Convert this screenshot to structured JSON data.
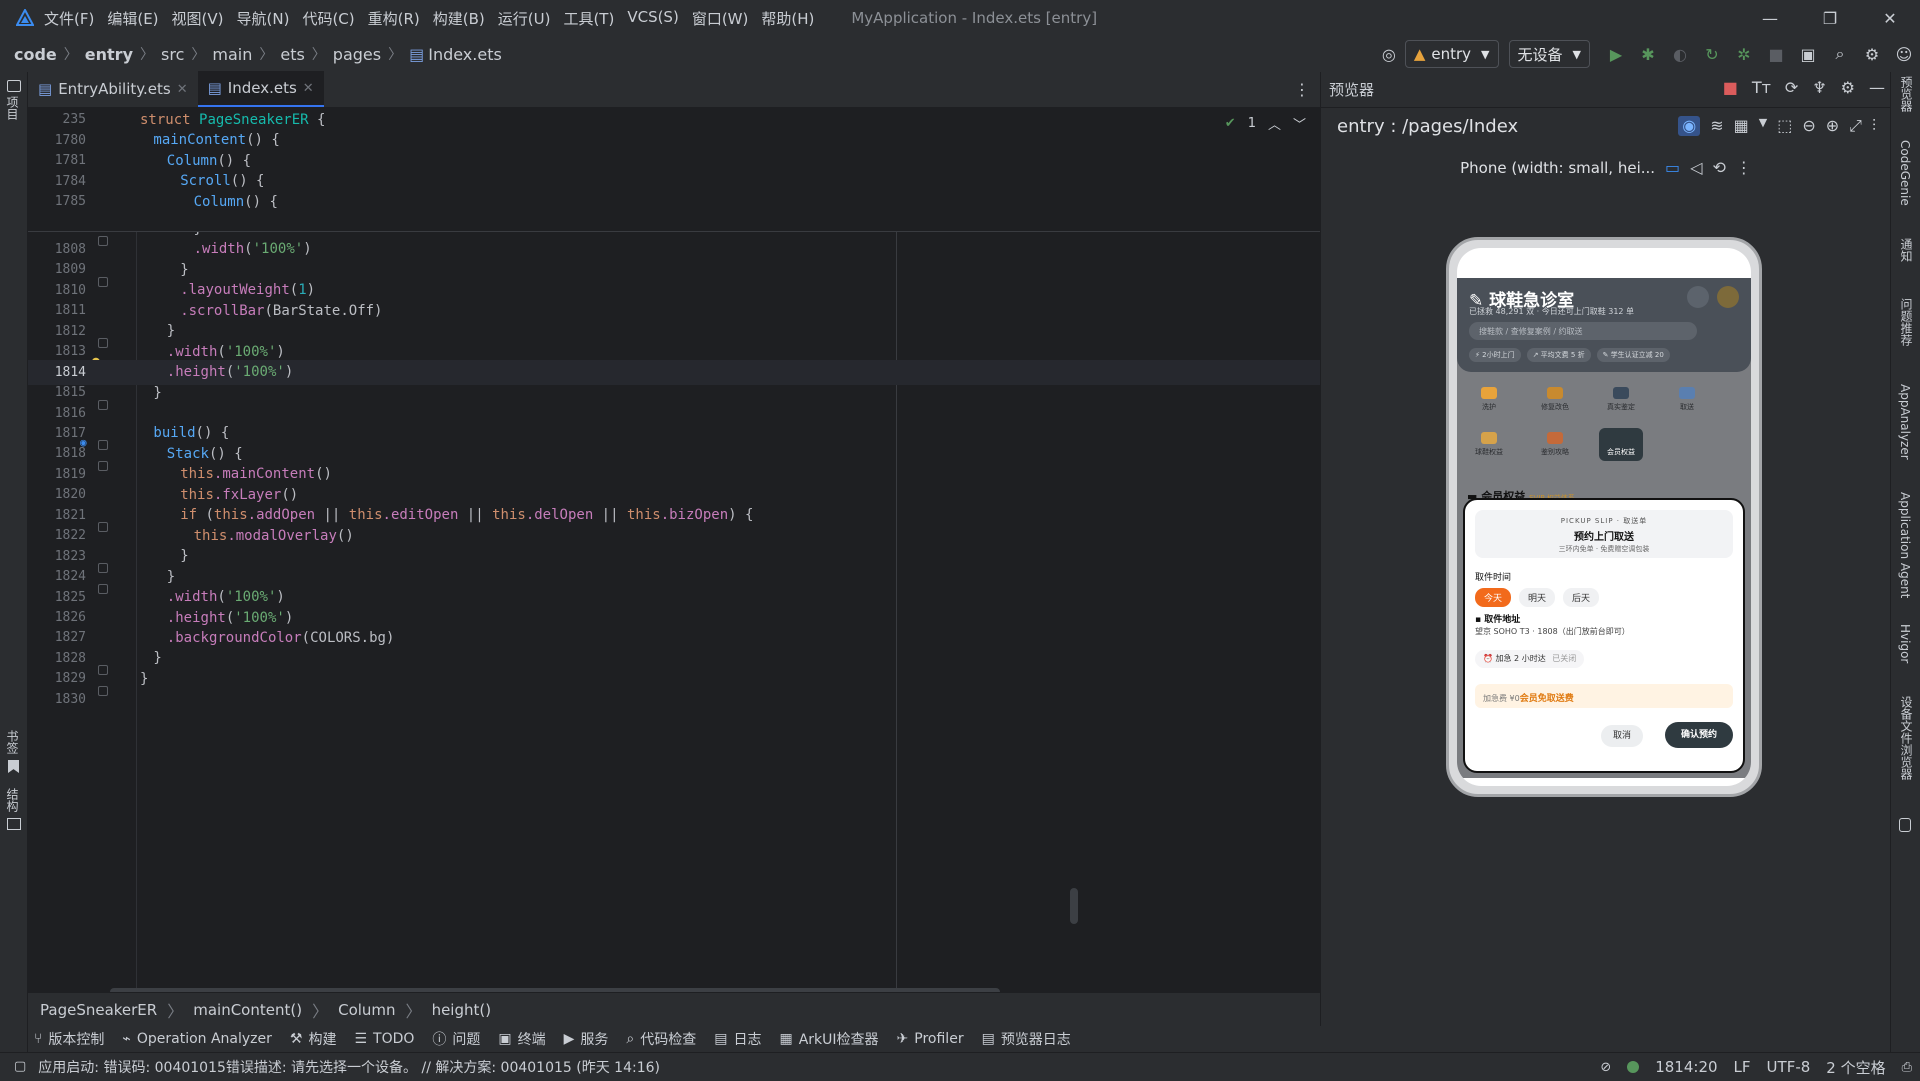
{
  "menubar": {
    "items": [
      "文件(F)",
      "编辑(E)",
      "视图(V)",
      "导航(N)",
      "代码(C)",
      "重构(R)",
      "构建(B)",
      "运行(U)",
      "工具(T)",
      "VCS(S)",
      "窗口(W)",
      "帮助(H)"
    ],
    "window_title": "MyApplication - Index.ets [entry]"
  },
  "nav": {
    "crumbs": [
      "code",
      "entry",
      "src",
      "main",
      "ets",
      "pages",
      "Index.ets"
    ],
    "module_select": "entry",
    "device_select": "无设备"
  },
  "left_strip": {
    "project": "项目",
    "bookmarks": "书签",
    "structure": "结构"
  },
  "tabs": [
    {
      "label": "EntryAbility.ets"
    },
    {
      "label": "Index.ets"
    }
  ],
  "editor": {
    "inspection_count": "1",
    "sticky": [
      {
        "n": "235",
        "tokens": [
          [
            "kw",
            "struct "
          ],
          [
            "type",
            "PageSneakerER"
          ],
          [
            "plain",
            " {"
          ]
        ],
        "indent": 0
      },
      {
        "n": "1780",
        "tokens": [
          [
            "fn",
            "mainContent"
          ],
          [
            "plain",
            "() {"
          ]
        ],
        "indent": 1
      },
      {
        "n": "1781",
        "tokens": [
          [
            "fn",
            "Column"
          ],
          [
            "plain",
            "() {"
          ]
        ],
        "indent": 2
      },
      {
        "n": "1784",
        "tokens": [
          [
            "fn",
            "Scroll"
          ],
          [
            "plain",
            "() {"
          ]
        ],
        "indent": 3
      },
      {
        "n": "1785",
        "tokens": [
          [
            "fn",
            "Column"
          ],
          [
            "plain",
            "() {"
          ]
        ],
        "indent": 4
      }
    ],
    "lines": [
      {
        "n": "1806",
        "tokens": [
          [
            "plain",
            "}"
          ]
        ],
        "indent": 5
      },
      {
        "n": "1807",
        "tokens": [
          [
            "plain",
            "}"
          ]
        ],
        "indent": 4
      },
      {
        "n": "1808",
        "tokens": [
          [
            "prop",
            ".width"
          ],
          [
            "plain",
            "("
          ],
          [
            "str",
            "'100%'"
          ],
          [
            "plain",
            ")"
          ]
        ],
        "indent": 4
      },
      {
        "n": "1809",
        "tokens": [
          [
            "plain",
            "}"
          ]
        ],
        "indent": 3
      },
      {
        "n": "1810",
        "tokens": [
          [
            "prop",
            ".layoutWeight"
          ],
          [
            "plain",
            "("
          ],
          [
            "num",
            "1"
          ],
          [
            "plain",
            ")"
          ]
        ],
        "indent": 3
      },
      {
        "n": "1811",
        "tokens": [
          [
            "prop",
            ".scrollBar"
          ],
          [
            "plain",
            "(BarState.Off)"
          ]
        ],
        "indent": 3
      },
      {
        "n": "1812",
        "tokens": [
          [
            "plain",
            "}"
          ]
        ],
        "indent": 2
      },
      {
        "n": "1813",
        "tokens": [
          [
            "prop",
            ".width"
          ],
          [
            "plain",
            "("
          ],
          [
            "str",
            "'100%'"
          ],
          [
            "plain",
            ")"
          ]
        ],
        "indent": 2
      },
      {
        "n": "1814",
        "tokens": [
          [
            "prop",
            ".height"
          ],
          [
            "plain",
            "("
          ],
          [
            "str",
            "'100%'"
          ],
          [
            "plain",
            ")"
          ]
        ],
        "indent": 2,
        "current": true
      },
      {
        "n": "1815",
        "tokens": [
          [
            "plain",
            "}"
          ]
        ],
        "indent": 1
      },
      {
        "n": "1816",
        "tokens": [],
        "indent": 0
      },
      {
        "n": "1817",
        "tokens": [
          [
            "fn",
            "build"
          ],
          [
            "plain",
            "() {"
          ]
        ],
        "indent": 1
      },
      {
        "n": "1818",
        "tokens": [
          [
            "fn",
            "Stack"
          ],
          [
            "plain",
            "() {"
          ]
        ],
        "indent": 2
      },
      {
        "n": "1819",
        "tokens": [
          [
            "kw",
            "this"
          ],
          [
            "member",
            ".mainContent"
          ],
          [
            "plain",
            "()"
          ]
        ],
        "indent": 3
      },
      {
        "n": "1820",
        "tokens": [
          [
            "kw",
            "this"
          ],
          [
            "member",
            ".fxLayer"
          ],
          [
            "plain",
            "()"
          ]
        ],
        "indent": 3
      },
      {
        "n": "1821",
        "tokens": [
          [
            "kw",
            "if "
          ],
          [
            "plain",
            "("
          ],
          [
            "kw",
            "this"
          ],
          [
            "member",
            ".addOpen"
          ],
          [
            "plain",
            " || "
          ],
          [
            "kw",
            "this"
          ],
          [
            "member",
            ".editOpen"
          ],
          [
            "plain",
            " || "
          ],
          [
            "kw",
            "this"
          ],
          [
            "member",
            ".delOpen"
          ],
          [
            "plain",
            " || "
          ],
          [
            "kw",
            "this"
          ],
          [
            "member",
            ".bizOpen"
          ],
          [
            "plain",
            ") {"
          ]
        ],
        "indent": 3
      },
      {
        "n": "1822",
        "tokens": [
          [
            "kw",
            "this"
          ],
          [
            "member",
            ".modalOverlay"
          ],
          [
            "plain",
            "()"
          ]
        ],
        "indent": 4
      },
      {
        "n": "1823",
        "tokens": [
          [
            "plain",
            "}"
          ]
        ],
        "indent": 3
      },
      {
        "n": "1824",
        "tokens": [
          [
            "plain",
            "}"
          ]
        ],
        "indent": 2
      },
      {
        "n": "1825",
        "tokens": [
          [
            "prop",
            ".width"
          ],
          [
            "plain",
            "("
          ],
          [
            "str",
            "'100%'"
          ],
          [
            "plain",
            ")"
          ]
        ],
        "indent": 2
      },
      {
        "n": "1826",
        "tokens": [
          [
            "prop",
            ".height"
          ],
          [
            "plain",
            "("
          ],
          [
            "str",
            "'100%'"
          ],
          [
            "plain",
            ")"
          ]
        ],
        "indent": 2
      },
      {
        "n": "1827",
        "tokens": [
          [
            "prop",
            ".backgroundColor"
          ],
          [
            "plain",
            "(COLORS.bg)"
          ]
        ],
        "indent": 2
      },
      {
        "n": "1828",
        "tokens": [
          [
            "plain",
            "}"
          ]
        ],
        "indent": 1
      },
      {
        "n": "1829",
        "tokens": [
          [
            "plain",
            "}"
          ]
        ],
        "indent": 0
      },
      {
        "n": "1830",
        "tokens": [],
        "indent": 0
      }
    ]
  },
  "editor_breadcrumb": [
    "PageSneakerER",
    "mainContent()",
    "Column",
    "height()"
  ],
  "tool_windows": [
    "版本控制",
    "Operation Analyzer",
    "构建",
    "TODO",
    "问题",
    "终端",
    "服务",
    "代码检查",
    "日志",
    "ArkUI检查器",
    "Profiler",
    "预览器日志"
  ],
  "status": {
    "message": "应用启动: 错误码: 00401015错误描述: 请先选择一个设备。 // 解决方案: 00401015 (昨天 14:16)",
    "position": "1814:20",
    "line_sep": "LF",
    "encoding": "UTF-8",
    "indent": "2 个空格"
  },
  "previewer": {
    "title": "预览器",
    "route": "entry : /pages/Index",
    "device_label": "Phone (width: small, hei...",
    "app": {
      "title": "球鞋急诊室",
      "subtitle": "已拯救 48,291 双 · 今日还可上门取鞋 312 单",
      "search_placeholder": "搜鞋款 / 查修复案例 / 约取送",
      "tags": [
        "⚡ 2小时上门",
        "↗ 平均文费 5 折",
        "✎ 学生认证立减 20"
      ],
      "grid": [
        "洗护",
        "修复改色",
        "真实鉴定",
        "取送",
        "球鞋权益",
        "鉴别攻略",
        "会员权益"
      ],
      "section_title": "会员权益",
      "section_sub": "SVIP 权益体系",
      "sheet": {
        "kicker": "PICKUP SLIP · 取送单",
        "title": "预约上门取送",
        "subtitle": "三环内免单 · 免费赠空调包装",
        "time_label": "取件时间",
        "time_options": [
          "今天",
          "明天",
          "后天"
        ],
        "addr_label": "取件地址",
        "addr_value": "望京 SOHO T3 · 1808（出门放前台即可）",
        "urgent_label": "加急 2 小时达",
        "urgent_state": "已关闭",
        "fee_prefix": "加急费 ¥0",
        "fee_highlight": "会员免取送费",
        "cancel": "取消",
        "confirm": "确认预约"
      }
    }
  },
  "right_strip": [
    "预览器",
    "CodeGenie",
    "通知",
    "问题推荐",
    "AppAnalyzer",
    "Application Agent",
    "Hvigor",
    "设备文件浏览器"
  ]
}
